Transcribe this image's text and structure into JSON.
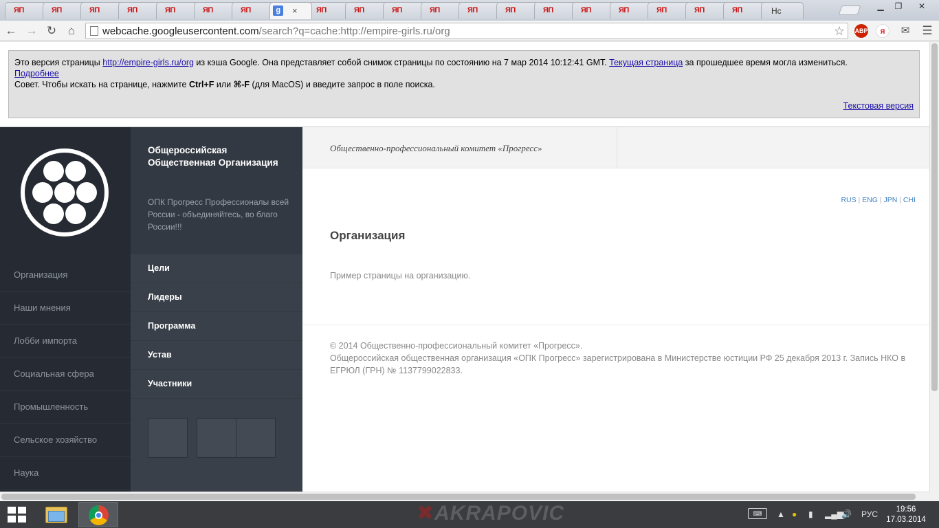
{
  "browser": {
    "tabs": [
      {
        "label": "ЯП"
      },
      {
        "label": "ЯП"
      },
      {
        "label": "ЯП"
      },
      {
        "label": "ЯП"
      },
      {
        "label": "ЯП"
      },
      {
        "label": "ЯП"
      },
      {
        "label": "ЯП"
      },
      {
        "label": "g",
        "active": true,
        "close": "×"
      },
      {
        "label": "ЯП"
      },
      {
        "label": "ЯП"
      },
      {
        "label": "ЯП"
      },
      {
        "label": "ЯП"
      },
      {
        "label": "ЯП"
      },
      {
        "label": "ЯП"
      },
      {
        "label": "ЯП"
      },
      {
        "label": "ЯП"
      },
      {
        "label": "ЯП"
      },
      {
        "label": "ЯП"
      },
      {
        "label": "ЯП"
      },
      {
        "label": "ЯП"
      },
      {
        "label": "Hc"
      }
    ],
    "url_host": "webcache.googleusercontent.com",
    "url_path": "/search?q=cache:http://empire-girls.ru/org",
    "extensions": [
      {
        "name": "adblock-icon",
        "text": "ABP",
        "color": "#cc2200"
      },
      {
        "name": "yandex-icon",
        "text": "Я",
        "color": "#ffffff"
      }
    ],
    "window_buttons": {
      "minimize": "▁",
      "maximize": "❐",
      "close": "✕"
    }
  },
  "cache_banner": {
    "part1": "Это версия страницы ",
    "link_url": "http://empire-girls.ru/org",
    "part2": " из кэша Google. Она представляет собой снимок страницы по состоянию на 7 мар 2014 10:12:41 GMT. ",
    "link_current": "Текущая страница",
    "part3": " за прошедшее время могла измениться.",
    "link_more": "Подробнее",
    "tip_prefix": "Совет. Чтобы искать на странице, нажмите ",
    "tip_key1": "Ctrl+F",
    "tip_mid": " или ",
    "tip_key2": "⌘-F",
    "tip_suffix": " (для MacOS) и введите запрос в поле поиска.",
    "text_version": "Текстовая версия"
  },
  "site": {
    "left_nav": [
      "Организация",
      "Наши мнения",
      "Лобби импорта",
      "Социальная сфера",
      "Промышленность",
      "Сельское хозяйство",
      "Наука"
    ],
    "org_title": "Общероссийская Общественная Организация",
    "org_sub": "ОПК Прогресс Профессионалы всей России - объединяйтесь, во благо России!!!",
    "mid_nav": [
      "Цели",
      "Лидеры",
      "Программа",
      "Устав",
      "Участники"
    ],
    "social_buttons": [
      "",
      "",
      ""
    ],
    "header_title": "Общественно-профессиональный комитет «Прогресс»",
    "langs": [
      "RUS",
      "ENG",
      "JPN",
      "CHI"
    ],
    "page_title": "Организация",
    "page_text": "Пример страницы на организацию.",
    "footer_line1": "© 2014 Общественно-профессиональный комитет «Прогресс».",
    "footer_line2": "Общероссийская общественная организация «ОПК Прогресс» зарегистрирована в Министерстве юстиции РФ 25 декабря 2013 г. Запись НКО в ЕГРЮЛ (ГРН) № 1137799022833."
  },
  "taskbar": {
    "wallpaper_text": "AKRAPOVIC",
    "language": "РУС",
    "time": "19:56",
    "date": "17.03.2014"
  }
}
